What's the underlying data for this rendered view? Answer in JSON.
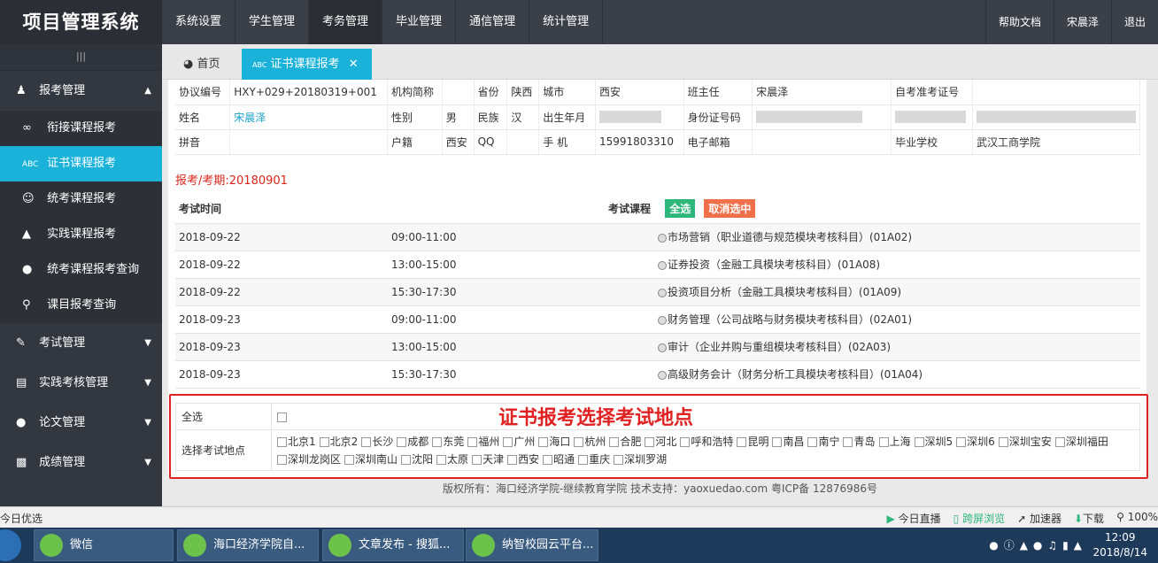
{
  "app_title": "项目管理系统",
  "top_nav": [
    "系统设置",
    "学生管理",
    "考务管理",
    "毕业管理",
    "通信管理",
    "统计管理"
  ],
  "top_right": [
    "帮助文档",
    "宋晨泽",
    "退出"
  ],
  "sidebar": {
    "toggle": "|||",
    "groups": [
      {
        "label": "报考管理",
        "icon": "user-gear-icon",
        "expanded": true
      },
      {
        "label": "考试管理",
        "icon": "pencil-icon"
      },
      {
        "label": "实践考核管理",
        "icon": "document-icon"
      },
      {
        "label": "论文管理",
        "icon": "chat-icon"
      },
      {
        "label": "成绩管理",
        "icon": "bar-chart-icon"
      }
    ],
    "sub_items": [
      {
        "label": "衔接课程报考",
        "icon": "infinity-icon"
      },
      {
        "label": "证书课程报考",
        "icon": "abc-icon",
        "active": true
      },
      {
        "label": "统考课程报考",
        "icon": "smile-icon"
      },
      {
        "label": "实践课程报考",
        "icon": "flask-icon"
      },
      {
        "label": "统考课程报考查询",
        "icon": "user-icon"
      },
      {
        "label": "课目报考查询",
        "icon": "search-icon"
      }
    ]
  },
  "tabs": {
    "home": "首页",
    "current": "证书课程报考"
  },
  "info": {
    "agreement_label": "协议编号",
    "agreement_value": "HXY+029+20180319+001",
    "org_label": "机构简称",
    "org_value": "",
    "province_label": "省份",
    "province_value": "陕西",
    "city_label": "城市",
    "city_value": "西安",
    "teacher_label": "班主任",
    "teacher_value": "宋晨泽",
    "exam_no_label": "自考准考证号",
    "exam_no_value": "",
    "name_label": "姓名",
    "name_value": "宋晨泽",
    "gender_label": "性别",
    "gender_value": "男",
    "ethnic_label": "民族",
    "ethnic_value": "汉",
    "birth_label": "出生年月",
    "id_label": "身份证号码",
    "pinyin_label": "拼音",
    "pinyin_value": "",
    "hukou_label": "户籍",
    "hukou_value": "西安",
    "qq_label": "QQ",
    "qq_value": "",
    "phone_label": "手 机",
    "phone_value": "15991803310",
    "email_label": "电子邮箱",
    "email_value": "",
    "school_label": "毕业学校",
    "school_value": "武汉工商学院"
  },
  "period": "报考/考期:20180901",
  "exam_header": {
    "time": "考试时间",
    "course": "考试课程",
    "select_all": "全选",
    "deselect": "取消选中"
  },
  "exams": [
    {
      "date": "2018-09-22",
      "time": "09:00-11:00",
      "course": "市场营销（职业道德与规范模块考核科目）(01A02)"
    },
    {
      "date": "2018-09-22",
      "time": "13:00-15:00",
      "course": "证券投资（金融工具模块考核科目）(01A08)"
    },
    {
      "date": "2018-09-22",
      "time": "15:30-17:30",
      "course": "投资项目分析（金融工具模块考核科目）(01A09)"
    },
    {
      "date": "2018-09-23",
      "time": "09:00-11:00",
      "course": "财务管理（公司战略与财务模块考核科目）(02A01)"
    },
    {
      "date": "2018-09-23",
      "time": "13:00-15:00",
      "course": "审计（企业并购与重组模块考核科目）(02A03)"
    },
    {
      "date": "2018-09-23",
      "time": "15:30-17:30",
      "course": "高级财务会计（财务分析工具模块考核科目）(01A04)"
    }
  ],
  "location": {
    "select_all_label": "全选",
    "label": "选择考试地点",
    "annotation": "证书报考选择考试地点",
    "places": [
      "北京1",
      "北京2",
      "长沙",
      "成都",
      "东莞",
      "福州",
      "广州",
      "海口",
      "杭州",
      "合肥",
      "河北",
      "呼和浩特",
      "昆明",
      "南昌",
      "南宁",
      "青岛",
      "上海",
      "深圳5",
      "深圳6",
      "深圳宝安",
      "深圳福田",
      "深圳龙岗区",
      "深圳南山",
      "沈阳",
      "太原",
      "天津",
      "西安",
      "昭通",
      "重庆",
      "深圳罗湖"
    ]
  },
  "footer": "版权所有：海口经济学院-继续教育学院 技术支持：yaoxuedao.com 粤ICP备 12876986号",
  "status_bar": {
    "left": "今日优选",
    "right": [
      "今日直播",
      "跨屏浏览",
      "加速器",
      "下载",
      "100%"
    ]
  },
  "taskbar": {
    "items": [
      "微信",
      "海口经济学院自...",
      "文章发布 - 搜狐...",
      "纳智校园云平台..."
    ],
    "time": "12:09",
    "date": "2018/8/14"
  },
  "colors": {
    "accent": "#1ab2d9",
    "topbar": "#3b3f48",
    "sidebar": "#333740",
    "highlight_red": "#e02222"
  }
}
